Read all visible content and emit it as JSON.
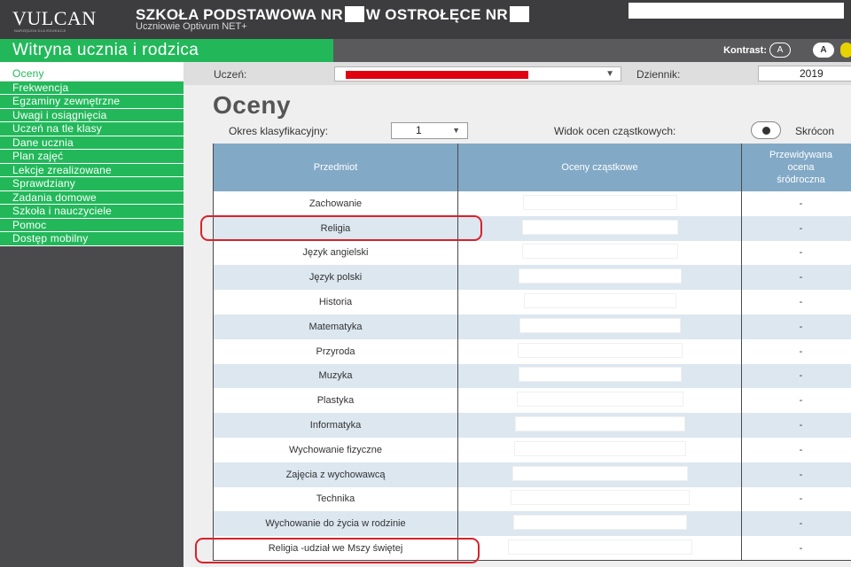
{
  "header": {
    "logo": "VULCAN",
    "logo_tagline": "NARZĘDZIA DLA EDUKACJI",
    "school_title_a": "SZKOŁA PODSTAWOWA NR",
    "school_title_b": "W OSTROŁĘCE NR",
    "school_subtitle": "Uczniowie Optivum NET+"
  },
  "app": {
    "title": "Witryna ucznia i rodzica",
    "contrast_label": "Kontrast:",
    "contrast_buttons": [
      "A",
      "A"
    ]
  },
  "sidebar": {
    "items": [
      {
        "label": "Oceny",
        "active": true
      },
      {
        "label": "Frekwencja"
      },
      {
        "label": "Egzaminy zewnętrzne"
      },
      {
        "label": "Uwagi i osiągnięcia"
      },
      {
        "label": "Uczeń na tle klasy"
      },
      {
        "label": "Dane ucznia"
      },
      {
        "label": "Plan zajęć"
      },
      {
        "label": "Lekcje zrealizowane"
      },
      {
        "label": "Sprawdziany"
      },
      {
        "label": "Zadania domowe"
      },
      {
        "label": "Szkoła i nauczyciele"
      },
      {
        "label": "Pomoc"
      },
      {
        "label": "Dostęp mobilny"
      }
    ]
  },
  "filters": {
    "student_label": "Uczeń:",
    "journal_label": "Dziennik:",
    "journal_value": "2019",
    "period_label": "Okres klasyfikacyjny:",
    "period_value": "1",
    "partial_view_label": "Widok ocen cząstkowych:",
    "short_label": "Skrócon"
  },
  "page": {
    "heading": "Oceny"
  },
  "table": {
    "headers": {
      "subject": "Przedmiot",
      "grades": "Oceny cząstkowe",
      "predicted_l1": "Przewidywana",
      "predicted_l2": "ocena",
      "predicted_l3": "śródroczna"
    },
    "rows": [
      {
        "subject": "Zachowanie",
        "predicted": "-"
      },
      {
        "subject": "Religia",
        "predicted": "-"
      },
      {
        "subject": "Język angielski",
        "predicted": "-"
      },
      {
        "subject": "Język polski",
        "predicted": "-"
      },
      {
        "subject": "Historia",
        "predicted": "-"
      },
      {
        "subject": "Matematyka",
        "predicted": "-"
      },
      {
        "subject": "Przyroda",
        "predicted": "-"
      },
      {
        "subject": "Muzyka",
        "predicted": "-"
      },
      {
        "subject": "Plastyka",
        "predicted": "-"
      },
      {
        "subject": "Informatyka",
        "predicted": "-"
      },
      {
        "subject": "Wychowanie fizyczne",
        "predicted": "-"
      },
      {
        "subject": "Zajęcia z wychowawcą",
        "predicted": "-"
      },
      {
        "subject": "Technika",
        "predicted": "-"
      },
      {
        "subject": "Wychowanie do życia w rodzinie",
        "predicted": "-"
      },
      {
        "subject": "Religia -udział we Mszy świętej",
        "predicted": "-"
      }
    ]
  },
  "colors": {
    "brand_green": "#22b85a",
    "header_dark": "#3d3d3f",
    "table_header_blue": "#82a9c6",
    "row_alt": "#dce7f0",
    "highlight_red": "#d8222a",
    "redaction_red": "#e10010"
  }
}
